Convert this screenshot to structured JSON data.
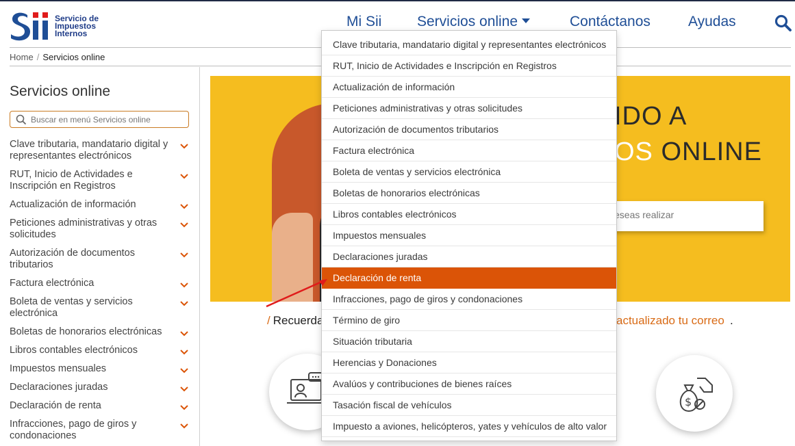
{
  "header": {
    "logo_text": [
      "Servicio de",
      "Impuestos",
      "Internos"
    ],
    "nav": [
      "Mi Sii",
      "Servicios online",
      "Contáctanos",
      "Ayudas"
    ]
  },
  "breadcrumb": {
    "home": "Home",
    "separator": "/",
    "current": "Servicios online"
  },
  "sidebar": {
    "title": "Servicios online",
    "search_placeholder": "Buscar en menú Servicios online",
    "items": [
      "Clave tributaria, mandatario digital y representantes electrónicos",
      "RUT, Inicio de Actividades e Inscripción en Registros",
      "Actualización de información",
      "Peticiones administrativas y otras solicitudes",
      "Autorización de documentos tributarios",
      "Factura electrónica",
      "Boleta de ventas y servicios electrónica",
      "Boletas de honorarios electrónicas",
      "Libros contables electrónicos",
      "Impuestos mensuales",
      "Declaraciones juradas",
      "Declaración de renta",
      "Infracciones, pago de giros y condonaciones"
    ]
  },
  "hero": {
    "line1": "IDO A",
    "line2_highlight": "OS",
    "line2_rest": " ONLINE",
    "search_placeholder": "eseas realizar"
  },
  "notice": {
    "slash": "/",
    "text": "Recuerda",
    "link": "actualizado tu correo",
    "end": "."
  },
  "dropdown": {
    "active_index": 11,
    "items": [
      "Clave tributaria, mandatario digital y representantes electrónicos",
      "RUT, Inicio de Actividades e Inscripción en Registros",
      "Actualización de información",
      "Peticiones administrativas y otras solicitudes",
      "Autorización de documentos tributarios",
      "Factura electrónica",
      "Boleta de ventas y servicios electrónica",
      "Boletas de honorarios electrónicas",
      "Libros contables electrónicos",
      "Impuestos mensuales",
      "Declaraciones juradas",
      "Declaración de renta",
      "Infracciones, pago de giros y condonaciones",
      "Término de giro",
      "Situación tributaria",
      "Herencias y Donaciones",
      "Avalúos y contribuciones de bienes raíces",
      "Tasación fiscal de vehículos",
      "Impuesto a aviones, helicópteros, yates y vehículos de alto valor"
    ]
  },
  "colors": {
    "brand_blue": "#1f4e96",
    "accent_orange": "#db5407",
    "hero_yellow": "#f5bd1f",
    "annotation_red": "#e01b1b"
  },
  "icons": {
    "search": "search-icon",
    "chevron": "chevron-down-icon",
    "circle_left": "online-meeting-icon",
    "circle_right": "money-bag-hand-icon"
  }
}
